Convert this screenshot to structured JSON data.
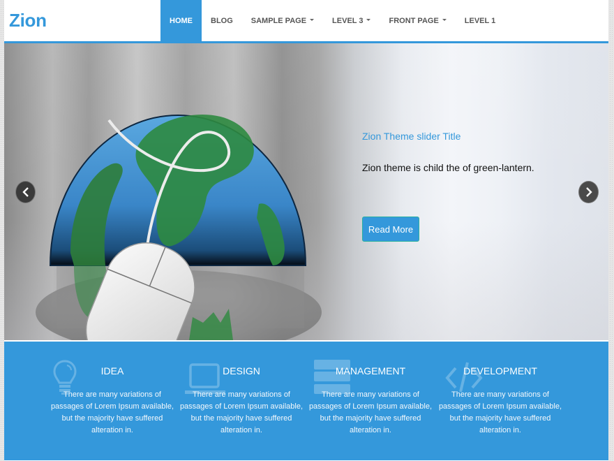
{
  "header": {
    "logo": "Zion",
    "nav": [
      {
        "label": "HOME",
        "active": true,
        "has_dropdown": false
      },
      {
        "label": "BLOG",
        "active": false,
        "has_dropdown": false
      },
      {
        "label": "SAMPLE PAGE",
        "active": false,
        "has_dropdown": true
      },
      {
        "label": "LEVEL 3",
        "active": false,
        "has_dropdown": true
      },
      {
        "label": "FRONT PAGE",
        "active": false,
        "has_dropdown": true
      },
      {
        "label": "LEVEL 1",
        "active": false,
        "has_dropdown": false
      }
    ]
  },
  "slider": {
    "title": "Zion Theme slider Title",
    "text": "Zion theme is child the of green-lantern.",
    "button": "Read More",
    "prev_icon": "chevron-left-icon",
    "next_icon": "chevron-right-icon",
    "image": "globe-with-mouse"
  },
  "features": [
    {
      "icon": "lightbulb-icon",
      "title": "IDEA",
      "text": "There are many variations of passages of Lorem Ipsum available, but the majority have suffered alteration in."
    },
    {
      "icon": "laptop-icon",
      "title": "DESIGN",
      "text": "There are many variations of passages of Lorem Ipsum available, but the majority have suffered alteration in."
    },
    {
      "icon": "server-icon",
      "title": "MANAGEMENT",
      "text": "There are many variations of passages of Lorem Ipsum available, but the majority have suffered alteration in."
    },
    {
      "icon": "code-icon",
      "title": "DEVELOPMENT",
      "text": "There are many variations of passages of Lorem Ipsum available, but the majority have suffered alteration in."
    }
  ],
  "colors": {
    "accent": "#3498db",
    "nav_text": "#555555",
    "arrow_bg": "#3a3a3a"
  }
}
